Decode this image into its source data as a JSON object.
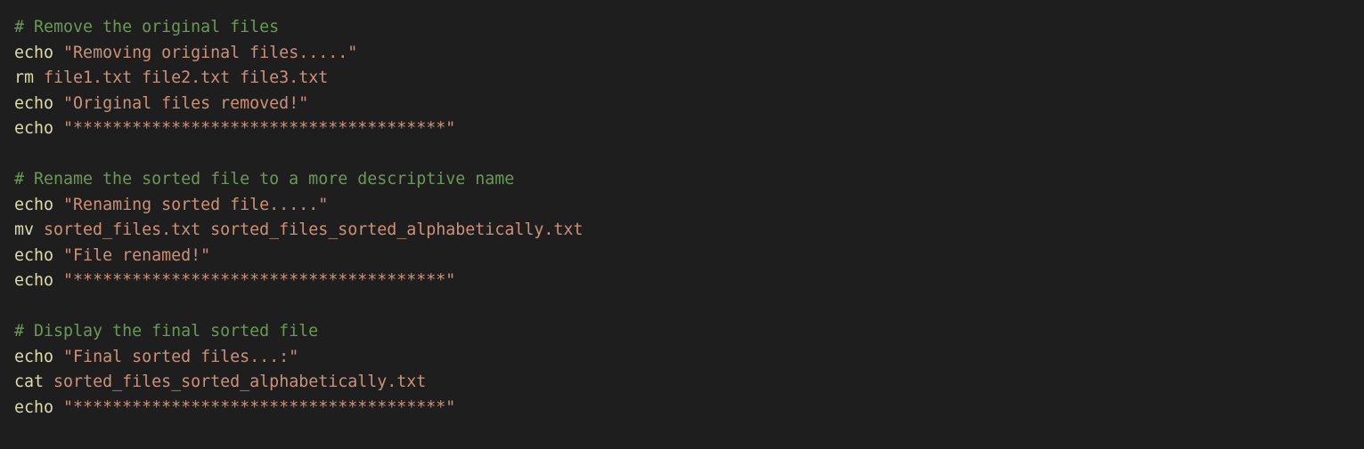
{
  "code": {
    "lines": [
      {
        "type": "comment",
        "text": "# Remove the original files"
      },
      {
        "type": "command",
        "cmd": "echo",
        "arg": "\"Removing original files.....\""
      },
      {
        "type": "command",
        "cmd": "rm",
        "arg": "file1.txt file2.txt file3.txt"
      },
      {
        "type": "command",
        "cmd": "echo",
        "arg": "\"Original files removed!\""
      },
      {
        "type": "command",
        "cmd": "echo",
        "arg": "\"**************************************\""
      },
      {
        "type": "blank"
      },
      {
        "type": "comment",
        "text": "# Rename the sorted file to a more descriptive name"
      },
      {
        "type": "command",
        "cmd": "echo",
        "arg": "\"Renaming sorted file.....\""
      },
      {
        "type": "command",
        "cmd": "mv",
        "arg": "sorted_files.txt sorted_files_sorted_alphabetically.txt"
      },
      {
        "type": "command",
        "cmd": "echo",
        "arg": "\"File renamed!\""
      },
      {
        "type": "command",
        "cmd": "echo",
        "arg": "\"**************************************\""
      },
      {
        "type": "blank"
      },
      {
        "type": "comment",
        "text": "# Display the final sorted file"
      },
      {
        "type": "command",
        "cmd": "echo",
        "arg": "\"Final sorted files...:\""
      },
      {
        "type": "command",
        "cmd": "cat",
        "arg": "sorted_files_sorted_alphabetically.txt"
      },
      {
        "type": "command",
        "cmd": "echo",
        "arg": "\"**************************************\""
      }
    ]
  },
  "colors": {
    "background": "#1e1e1e",
    "comment": "#6a9955",
    "command": "#dcdcaa",
    "string": "#ce9178"
  }
}
